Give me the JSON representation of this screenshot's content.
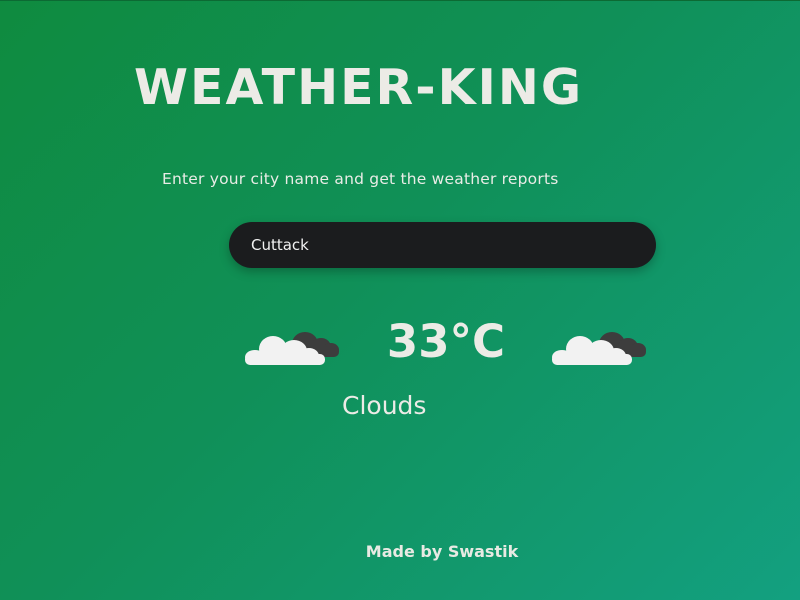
{
  "app": {
    "title": "WEATHER-KING",
    "subtitle": "Enter your city name and get the weather reports"
  },
  "search": {
    "value": "Cuttack",
    "placeholder": ""
  },
  "weather": {
    "temperature": "33°C",
    "condition": "Clouds",
    "icon": "cloud-icon"
  },
  "footer": {
    "credit": "Made by Swastik"
  },
  "colors": {
    "background_start": "#0f8b3f",
    "background_end": "#13a080",
    "input_background": "#1b1c1e",
    "text": "#ecebe6"
  }
}
